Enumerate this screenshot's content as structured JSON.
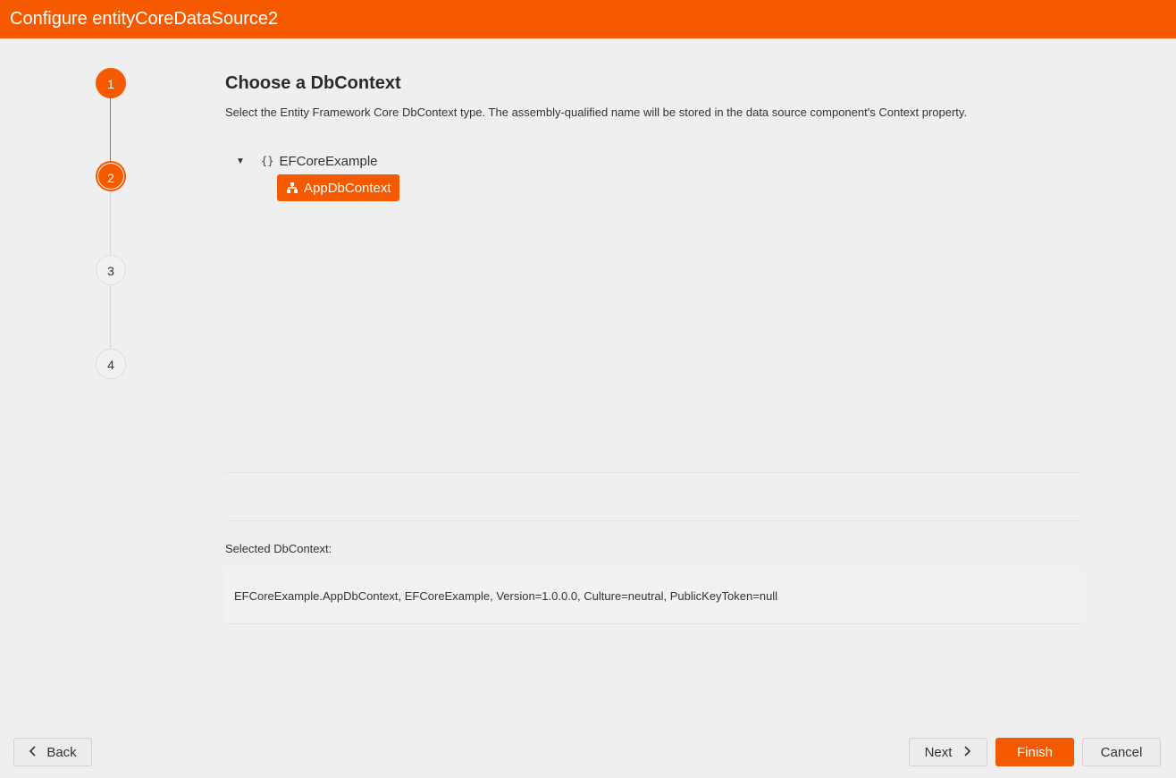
{
  "window": {
    "title": "Configure entityCoreDataSource2"
  },
  "stepper": {
    "steps": [
      {
        "label": "1",
        "state": "done"
      },
      {
        "label": "2",
        "state": "current"
      },
      {
        "label": "3",
        "state": "pending"
      },
      {
        "label": "4",
        "state": "pending"
      }
    ]
  },
  "main": {
    "title": "Choose a DbContext",
    "description": "Select the Entity Framework Core DbContext type. The assembly-qualified name will be stored in the data source component's Context property.",
    "tree": {
      "namespace": {
        "icon": "{}",
        "label": "EFCoreExample",
        "expanded": true
      },
      "selected_class": {
        "icon": "class-hierarchy-icon",
        "label": "AppDbContext"
      }
    },
    "selected_label": "Selected DbContext:",
    "selected_value": "EFCoreExample.AppDbContext, EFCoreExample, Version=1.0.0.0, Culture=neutral, PublicKeyToken=null"
  },
  "buttons": {
    "back": "Back",
    "next": "Next",
    "finish": "Finish",
    "cancel": "Cancel"
  },
  "colors": {
    "accent": "#f55a00",
    "background": "#efefef"
  }
}
